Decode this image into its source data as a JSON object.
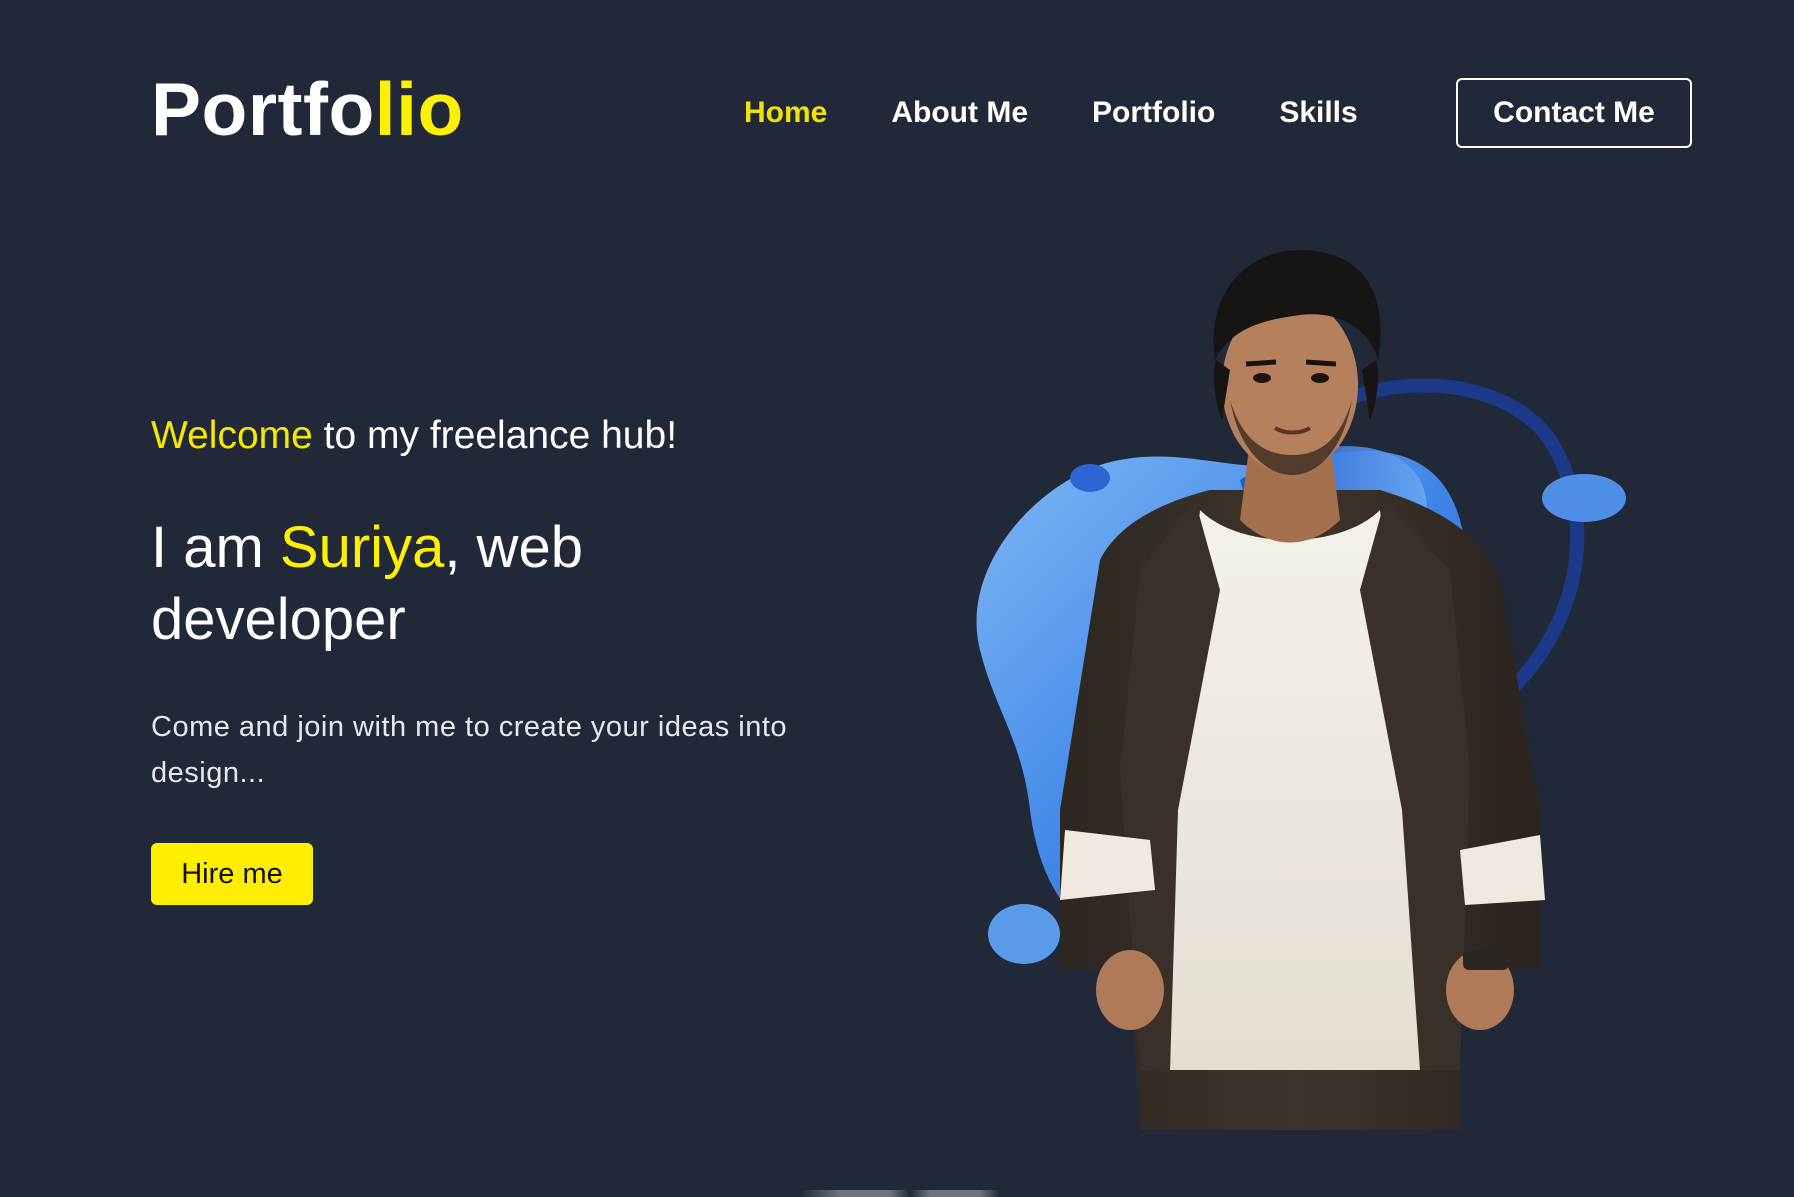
{
  "header": {
    "logo": {
      "main": "Portfo",
      "accent": "lio"
    },
    "nav": [
      {
        "label": "Home",
        "active": true
      },
      {
        "label": "About Me",
        "active": false
      },
      {
        "label": "Portfolio",
        "active": false
      },
      {
        "label": "Skills",
        "active": false
      }
    ],
    "contact_button": "Contact Me"
  },
  "hero": {
    "welcome": {
      "accent": "Welcome",
      "rest": " to my freelance hub!"
    },
    "headline": {
      "prefix": "I am ",
      "name": "Suriya",
      "suffix": ", web developer"
    },
    "intro": "Come and join with me to create your ideas into design...",
    "hire_button": "Hire me",
    "image": "portrait-photo"
  },
  "colors": {
    "background": "#212837",
    "accent": "#ffef00",
    "text": "#ffffff",
    "blob": "#3b82e6"
  }
}
